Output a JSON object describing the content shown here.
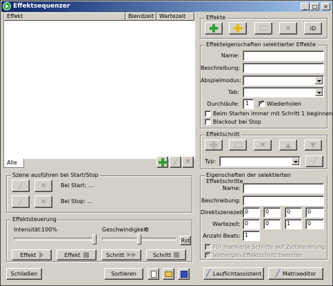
{
  "window": {
    "title": "Effektsequenzer",
    "min": "_",
    "max": "□",
    "close": "×"
  },
  "list": {
    "columns": [
      "Effekt",
      "Blendzeit",
      "Wartezeit"
    ],
    "tab": "Alle"
  },
  "scene": {
    "title": "Szene ausführen bei Start/Stop",
    "start_label": "Bei Start: ...",
    "stop_label": "Bei Stop: ..."
  },
  "control": {
    "title": "Effektsteuerung",
    "intensity_label": "Intensität:",
    "intensity_value": "100%",
    "speed_label": "Geschwindigkeit:",
    "speed_value": "0",
    "intensity_level": 1.0,
    "speed_level": 0.5,
    "rst": "Rst",
    "btn_effect_play": "Effekt",
    "btn_effect_stop": "Effekt",
    "btn_step_fwd": "Schritt",
    "btn_step_stop": "Schritt"
  },
  "bottom": {
    "close": "Schließen",
    "sort": "Sortieren"
  },
  "effects": {
    "title": "Effekte",
    "id_button": "ID"
  },
  "props": {
    "title": "Effekteigenschaften selektierter Effekte",
    "name_label": "Name:",
    "desc_label": "Beschreibung:",
    "mode_label": "Abspielmodus:",
    "tab_label": "Tab:",
    "runs_label": "Durchläufe:",
    "runs_value": "1",
    "repeat_label": "Wiederholen",
    "restart_label": "Beim Starten immer mit Schritt 1 beginnen",
    "blackout_label": "Blackout bei Stop"
  },
  "step": {
    "title": "Effektschritt",
    "type_label": "Typ:"
  },
  "stepprops": {
    "title": "Eigenschaften der selektierten Effektschritte",
    "name_label": "Name:",
    "desc_label": "Beschreibung:",
    "fade_label": "Direktszenezeit:",
    "wait_label": "Wartezeit:",
    "beats_label": "Anzahl Beats:",
    "fade_values": [
      "0",
      "0",
      "0",
      "0"
    ],
    "wait_values": [
      "0",
      "0",
      "1",
      "0"
    ],
    "beats_value": "1",
    "opt1": "Für markierte Schritte auf Zeitsteuerung",
    "opt2": "Vorhergen Effektschritt beenden"
  },
  "footer": {
    "wizard": "Lauflichtassistent",
    "matrix": "Matrixeditor"
  }
}
